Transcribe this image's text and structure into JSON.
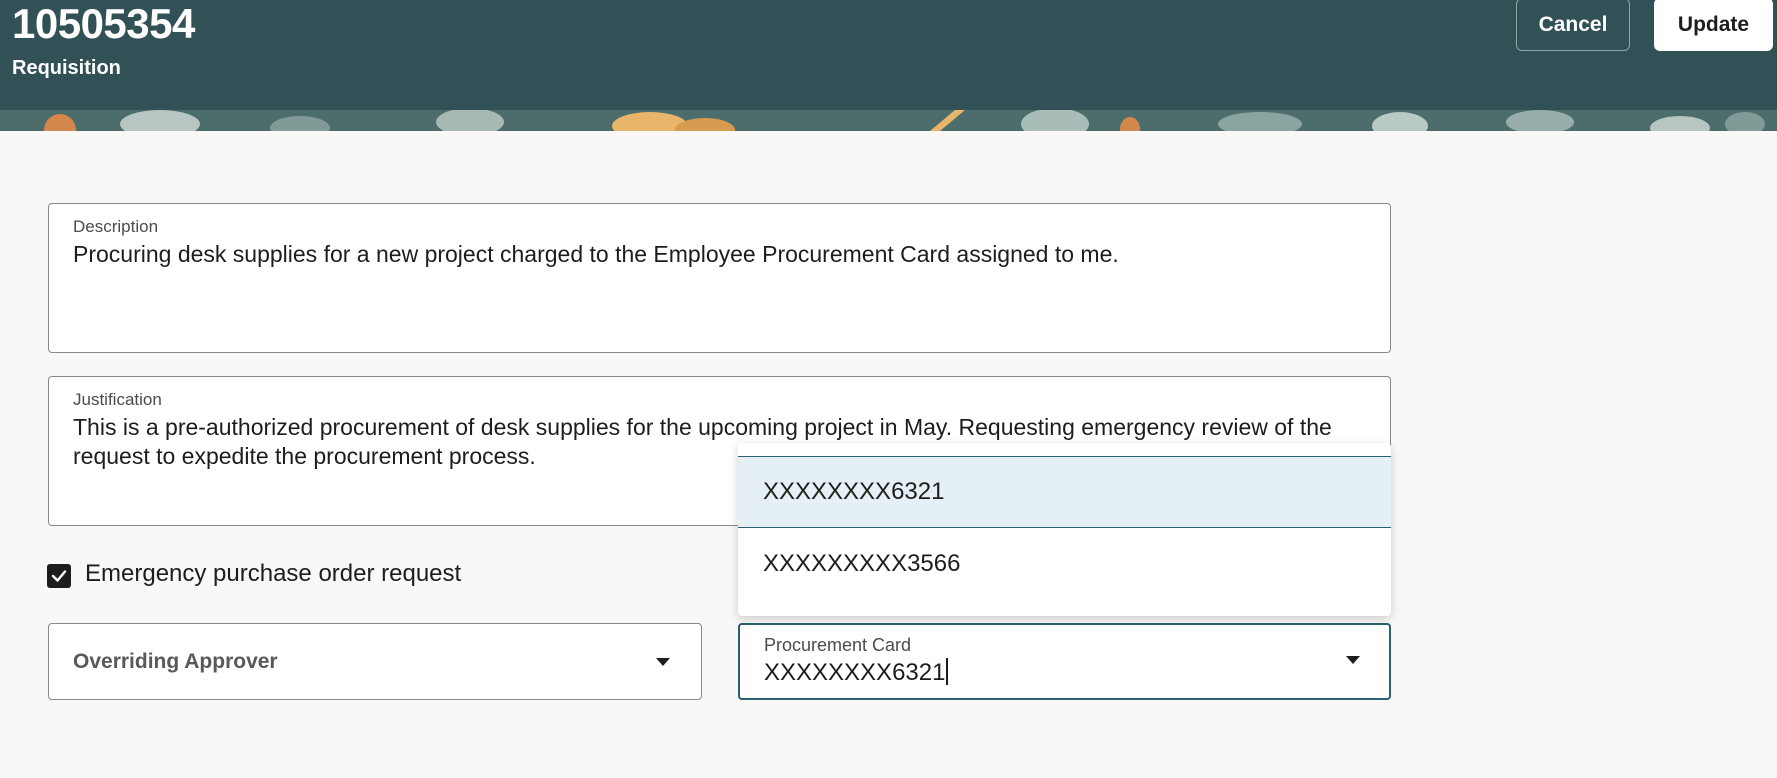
{
  "header": {
    "title": "10505354",
    "subtitle": "Requisition",
    "cancel_label": "Cancel",
    "update_label": "Update"
  },
  "description": {
    "label": "Description",
    "value": "Procuring desk supplies for a new project charged to the Employee Procurement Card assigned to me."
  },
  "justification": {
    "label": "Justification",
    "value": "This is a pre-authorized procurement of desk supplies for the upcoming project in May. Requesting emergency review of the request to expedite the procurement process."
  },
  "emergency": {
    "label": "Emergency purchase order request",
    "checked": true
  },
  "overriding_approver": {
    "placeholder": "Overriding Approver"
  },
  "procurement_card": {
    "label": "Procurement Card",
    "value": "XXXXXXXX6321",
    "options": [
      "XXXXXXXX6321",
      "XXXXXXXXX3566"
    ]
  },
  "colors": {
    "header_bg": "#325156",
    "page_bg": "#f9f8f6",
    "focus_border": "#2b6171",
    "selected_option_bg": "#e4f0f5"
  }
}
